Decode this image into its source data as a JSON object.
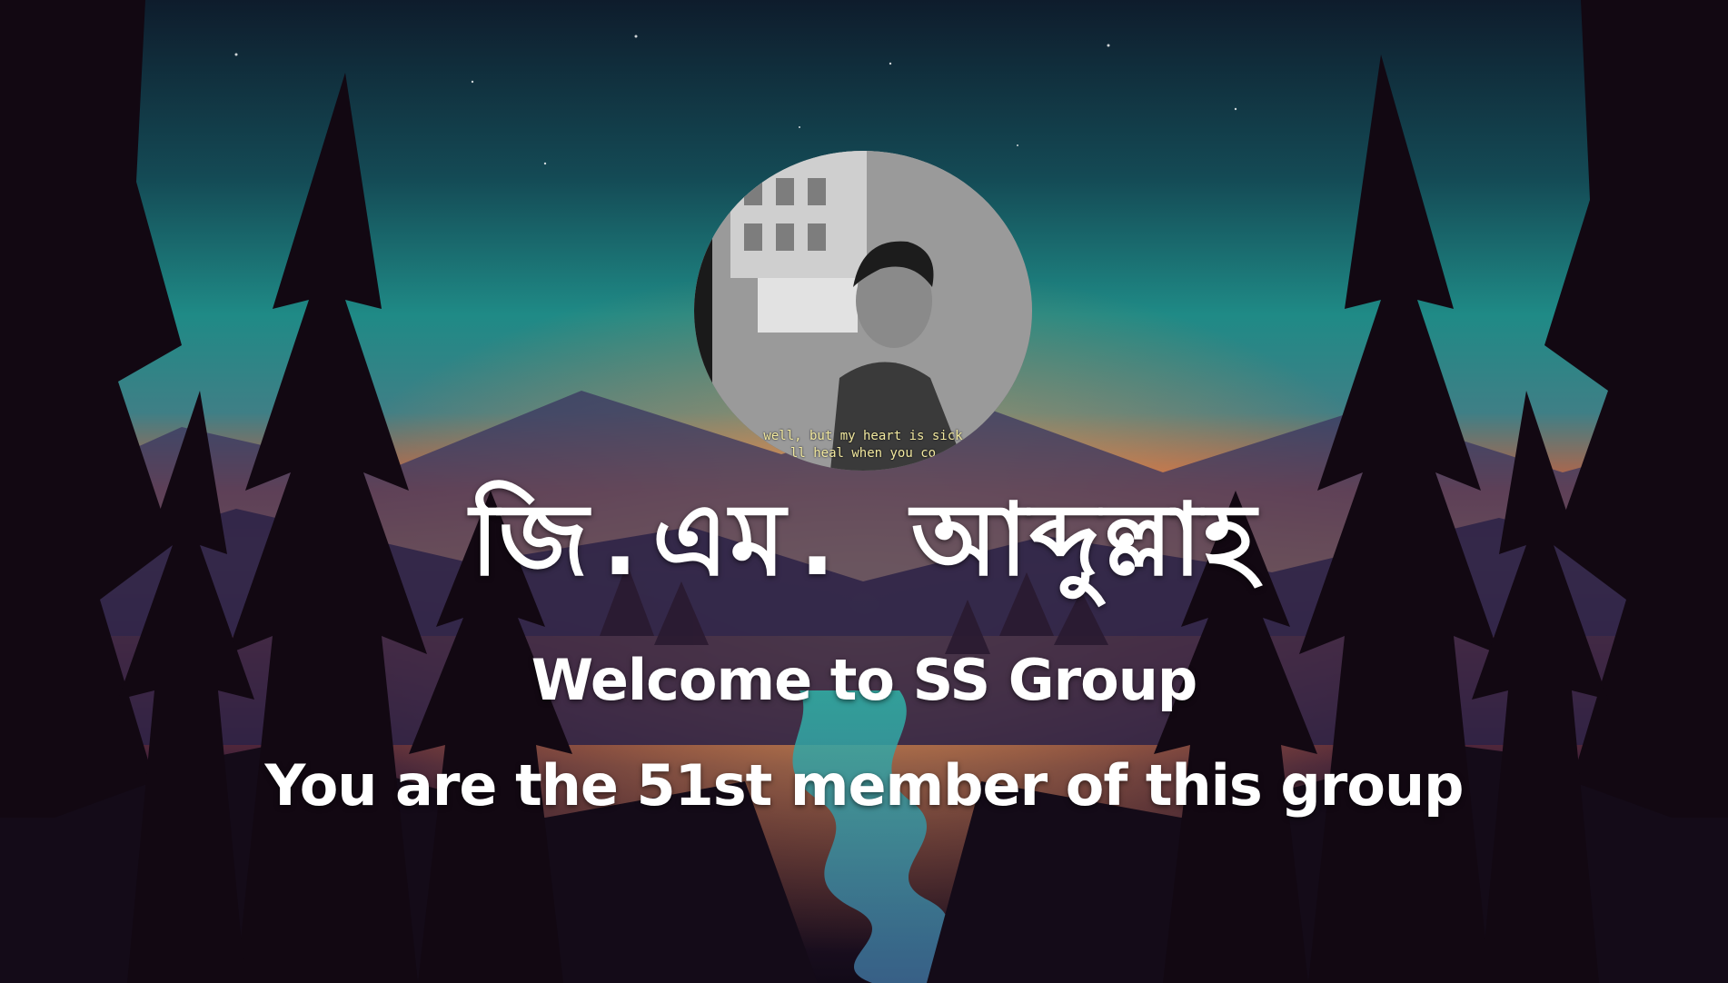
{
  "card": {
    "avatar_caption_line1": "well, but my heart is sick",
    "avatar_caption_line2": "ll heal when you co",
    "username": "জি.এম. আব্দুল্লাহ",
    "welcome_text": "Welcome to SS Group",
    "member_text": "You are the 51st member of this group"
  },
  "colors": {
    "text": "#ffffff",
    "sky_top": "#0e2230",
    "sky_teal": "#1f8a86",
    "sunset_orange": "#f08a3a",
    "tree_silhouette": "#120812"
  }
}
